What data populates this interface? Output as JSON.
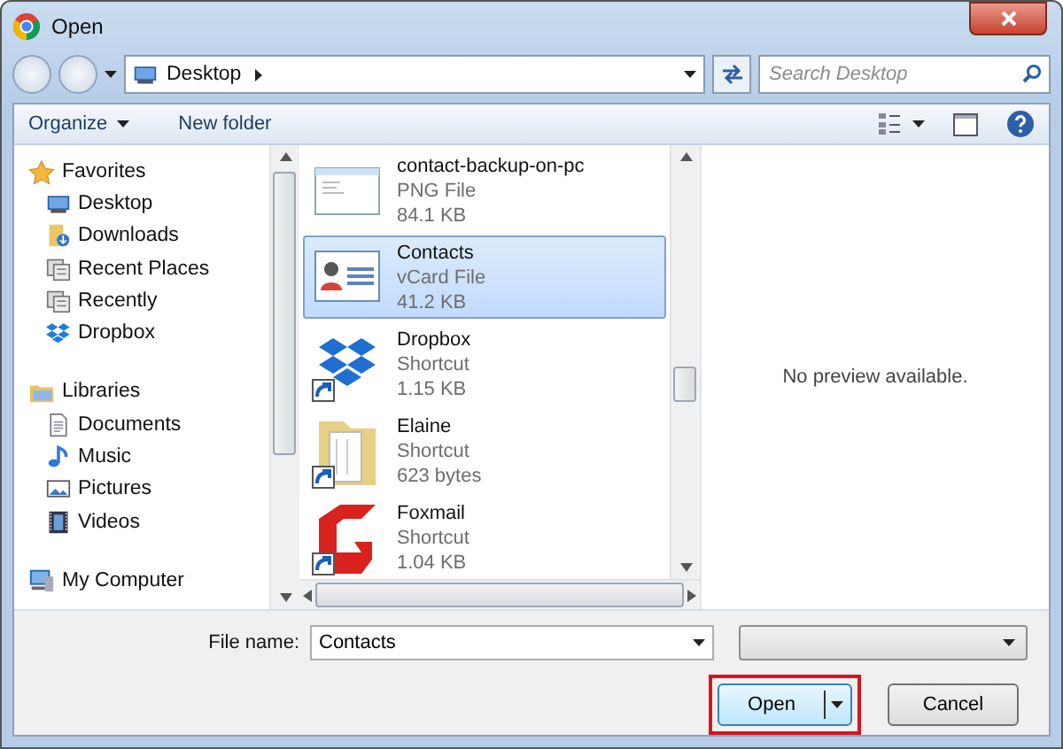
{
  "window": {
    "title": "Open"
  },
  "address": {
    "location": "Desktop",
    "search_placeholder": "Search Desktop"
  },
  "toolbar": {
    "buttons": [
      "Organize",
      "New folder"
    ]
  },
  "sidebar": {
    "groups": [
      {
        "label": "Favorites",
        "kind": "star",
        "children": [
          {
            "label": "Desktop",
            "kind": "desktop"
          },
          {
            "label": "Downloads",
            "kind": "downloads"
          },
          {
            "label": "Recent Places",
            "kind": "recent"
          },
          {
            "label": "Recently",
            "kind": "recent"
          },
          {
            "label": "Dropbox",
            "kind": "dropbox"
          }
        ]
      },
      {
        "label": "Libraries",
        "kind": "libraries",
        "children": [
          {
            "label": "Documents",
            "kind": "documents"
          },
          {
            "label": "Music",
            "kind": "music"
          },
          {
            "label": "Pictures",
            "kind": "pictures"
          },
          {
            "label": "Videos",
            "kind": "videos"
          }
        ]
      },
      {
        "label": "My Computer",
        "kind": "computer"
      }
    ]
  },
  "files": [
    {
      "name": "contact-backup-on-pc",
      "type": "PNG File",
      "size": "84.1 KB",
      "kind": "image",
      "shortcut": false,
      "selected": false
    },
    {
      "name": "Contacts",
      "type": "vCard File",
      "size": "41.2 KB",
      "kind": "vcard",
      "shortcut": false,
      "selected": true
    },
    {
      "name": "Dropbox",
      "type": "Shortcut",
      "size": "1.15 KB",
      "kind": "dropbox",
      "shortcut": true,
      "selected": false
    },
    {
      "name": "Elaine",
      "type": "Shortcut",
      "size": "623 bytes",
      "kind": "folder",
      "shortcut": true,
      "selected": false
    },
    {
      "name": "Foxmail",
      "type": "Shortcut",
      "size": "1.04 KB",
      "kind": "foxmail",
      "shortcut": true,
      "selected": false
    }
  ],
  "preview": {
    "message": "No preview available."
  },
  "file_name": {
    "label": "File name:",
    "value": "Contacts"
  },
  "buttons": [
    {
      "label": "Open",
      "kind": "split",
      "highlighted": true
    },
    {
      "label": "Cancel",
      "kind": "plain",
      "highlighted": false
    }
  ]
}
